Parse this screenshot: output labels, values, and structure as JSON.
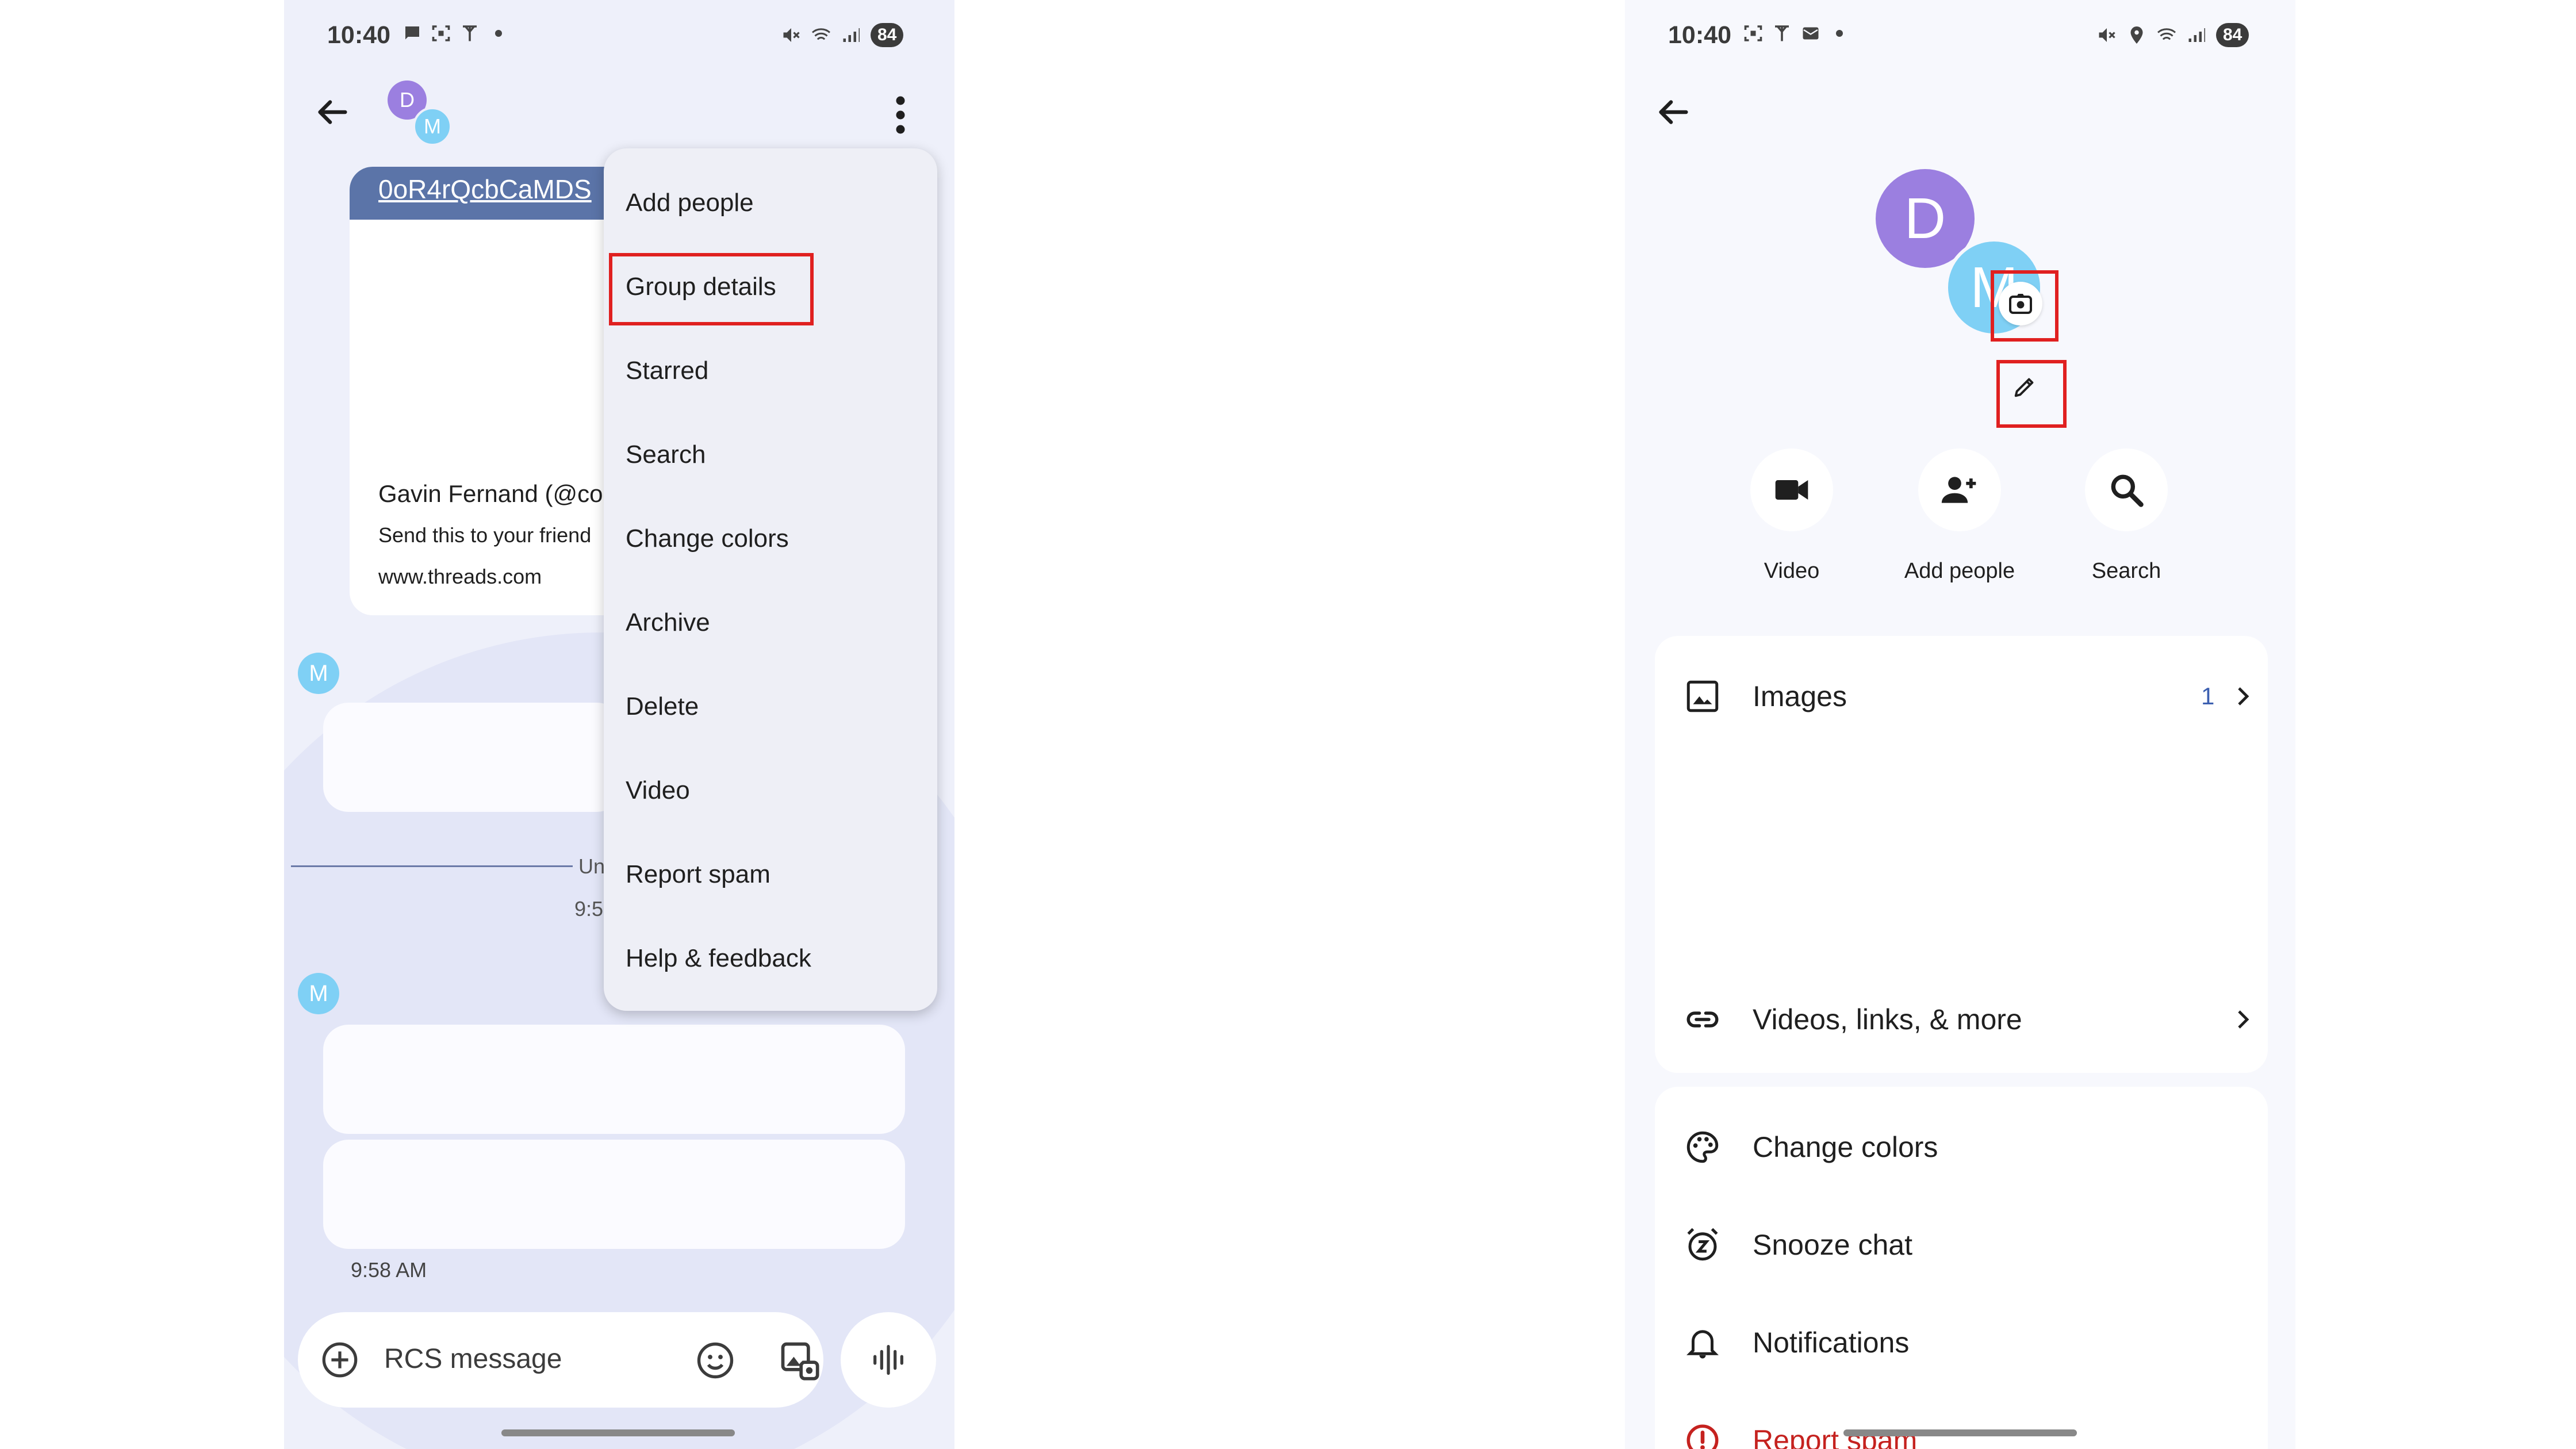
{
  "left_screen": {
    "status_bar": {
      "time": "10:40",
      "battery": "84"
    },
    "header": {
      "avatar_d": "D",
      "avatar_m": "M"
    },
    "link_card": {
      "link_text": "0oR4rQcbCaMDS",
      "author": "Gavin Fernand (@cor",
      "description": "Send this to your friend",
      "domain": "www.threads.com"
    },
    "messages": {
      "avatar_letter": "M",
      "divider_text": "Un",
      "divider_time": "9:5",
      "time": "9:58 AM"
    },
    "compose": {
      "placeholder": "RCS message"
    },
    "menu": {
      "items": [
        {
          "label": "Add people"
        },
        {
          "label": "Group details"
        },
        {
          "label": "Starred"
        },
        {
          "label": "Search"
        },
        {
          "label": "Change colors"
        },
        {
          "label": "Archive"
        },
        {
          "label": "Delete"
        },
        {
          "label": "Video"
        },
        {
          "label": "Report spam"
        },
        {
          "label": "Help & feedback"
        }
      ]
    }
  },
  "right_screen": {
    "status_bar": {
      "time": "10:40",
      "battery": "84"
    },
    "avatars": {
      "d": "D",
      "m": "M"
    },
    "actions": [
      {
        "label": "Video",
        "icon": "videocam-icon"
      },
      {
        "label": "Add people",
        "icon": "person-add-icon"
      },
      {
        "label": "Search",
        "icon": "search-icon"
      }
    ],
    "media_card": {
      "images_label": "Images",
      "images_count": "1",
      "videos_label": "Videos, links, & more"
    },
    "settings": {
      "change_colors": "Change colors",
      "snooze_chat": "Snooze chat",
      "notifications": "Notifications",
      "report_spam": "Report spam"
    }
  },
  "colors": {
    "highlight": "#e02020",
    "avatar_d": "#9b7fe0",
    "avatar_m": "#7fd0f5",
    "link_banner": "#5b74a8",
    "danger": "#c5221f",
    "accent_count": "#3c5fb0"
  }
}
